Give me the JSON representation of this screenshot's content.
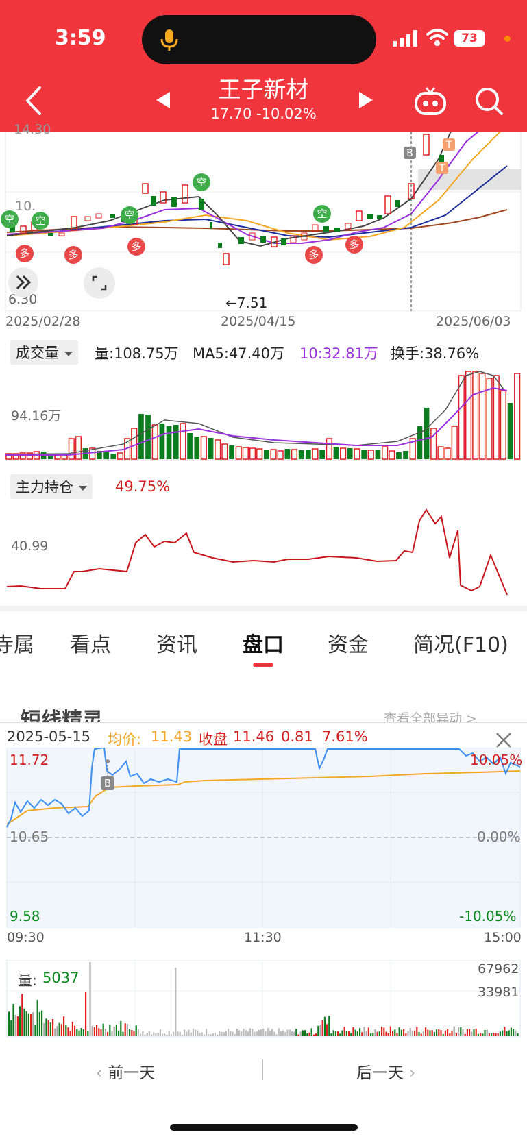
{
  "status_bar": {
    "time": "3:59",
    "battery": "73"
  },
  "header": {
    "stock_name": "王子新材",
    "quote": "17.70 -10.02%"
  },
  "kline": {
    "price_high": "14.30",
    "price_mid": "10.",
    "price_low": "6.30",
    "low_marker": "←7.51",
    "dates": [
      "2025/02/28",
      "2025/04/15",
      "2025/06/03"
    ],
    "signal_buy": "多",
    "signal_sell": "空",
    "marker_b": "B",
    "marker_t": "T"
  },
  "volume": {
    "selector": "成交量",
    "vol": "量:108.75万",
    "ma5": "MA5:47.40万",
    "ma10": "10:32.81万",
    "turnover": "换手:38.76%",
    "axis_value": "94.16万",
    "chart_data": {
      "type": "bar",
      "series_values": [
        8,
        8,
        9,
        9,
        11,
        11,
        8,
        6,
        7,
        30,
        33,
        16,
        16,
        12,
        11,
        8,
        9,
        30,
        45,
        66,
        65,
        50,
        52,
        48,
        50,
        52,
        38,
        33,
        33,
        31,
        28,
        22,
        20,
        18,
        17,
        16,
        15,
        14,
        14,
        12,
        15,
        14,
        13,
        14,
        15,
        14,
        30,
        18,
        16,
        16,
        15,
        14,
        13,
        14,
        18,
        12,
        10,
        12,
        30,
        48,
        75,
        45,
        18,
        16,
        48,
        122,
        128,
        128,
        125,
        118,
        122,
        100,
        82,
        125
      ]
    }
  },
  "holdings": {
    "selector": "主力持仓",
    "value": "49.75%",
    "axis_value": "40.99"
  },
  "tabs": [
    "寺属",
    "看点",
    "资讯",
    "盘口",
    "资金",
    "简况(F10)"
  ],
  "active_tab": "盘口",
  "sub_section": {
    "title": "短线精灵",
    "view_all": "查看全部异动 >"
  },
  "intraday": {
    "date": "2025-05-15",
    "avg_label": "均价:",
    "avg_value": "11.43",
    "close_label": "收盘",
    "close_value": "11.46",
    "change": "0.81",
    "change_pct": "7.61%",
    "price_high": "11.72",
    "price_base": "10.65",
    "price_low": "9.58",
    "pct_high": "10.05%",
    "pct_base": "0.00%",
    "pct_low": "-10.05%",
    "times": [
      "09:30",
      "11:30",
      "15:00"
    ],
    "marker_b": "B",
    "vol_label": "量:",
    "vol_value": "5037",
    "vol_axis_high": "67962",
    "vol_axis_mid": "33981"
  },
  "nav": {
    "prev": "前一天",
    "next": "后一天"
  },
  "colors": {
    "brand_red": "#f0353d",
    "up": "#e02020",
    "down": "#0a7d1e",
    "ma_purple": "#9b30e0",
    "avg_orange": "#f5a623",
    "line_blue": "#3b8ff0"
  }
}
